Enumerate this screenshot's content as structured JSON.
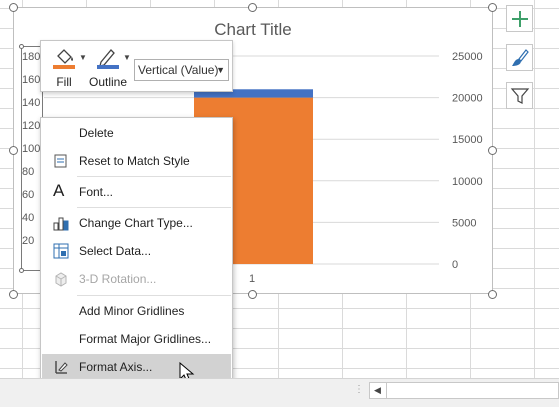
{
  "chart": {
    "title": "Chart Title",
    "left_axis_ticks": [
      "180",
      "160",
      "140",
      "120",
      "100",
      "80",
      "60",
      "40",
      "20"
    ],
    "right_axis_ticks": [
      "25000",
      "20000",
      "15000",
      "10000",
      "5000",
      "0"
    ],
    "category_label": "1",
    "colors": {
      "bar_orange": "#ed7d31",
      "bar_blue": "#4472c4",
      "gridline": "#d9d9d9"
    }
  },
  "chart_data": {
    "type": "bar",
    "categories": [
      "1"
    ],
    "series": [
      {
        "values": [
          20000
        ]
      },
      {
        "values": [
          1000
        ]
      }
    ],
    "ylim": [
      0,
      25000
    ],
    "stacked": true
  },
  "mini_toolbar": {
    "fill_label": "Fill",
    "outline_label": "Outline",
    "element_select": "Vertical (Value)"
  },
  "context_menu": {
    "items": [
      {
        "label": "Delete",
        "icon": "none"
      },
      {
        "label": "Reset to Match Style",
        "icon": "reset-style-icon"
      },
      {
        "label": "Font...",
        "icon": "font-icon"
      },
      {
        "label": "Change Chart Type...",
        "icon": "chart-type-icon"
      },
      {
        "label": "Select Data...",
        "icon": "select-data-icon"
      },
      {
        "label": "3-D Rotation...",
        "icon": "rotation-3d-icon",
        "disabled": true
      },
      {
        "label": "Add Minor Gridlines",
        "icon": "none"
      },
      {
        "label": "Format Major Gridlines...",
        "icon": "none"
      },
      {
        "label": "Format Axis...",
        "icon": "format-axis-icon",
        "highlighted": true
      }
    ]
  },
  "side_buttons": [
    "chart-elements-icon",
    "chart-styles-icon",
    "chart-filters-icon"
  ]
}
